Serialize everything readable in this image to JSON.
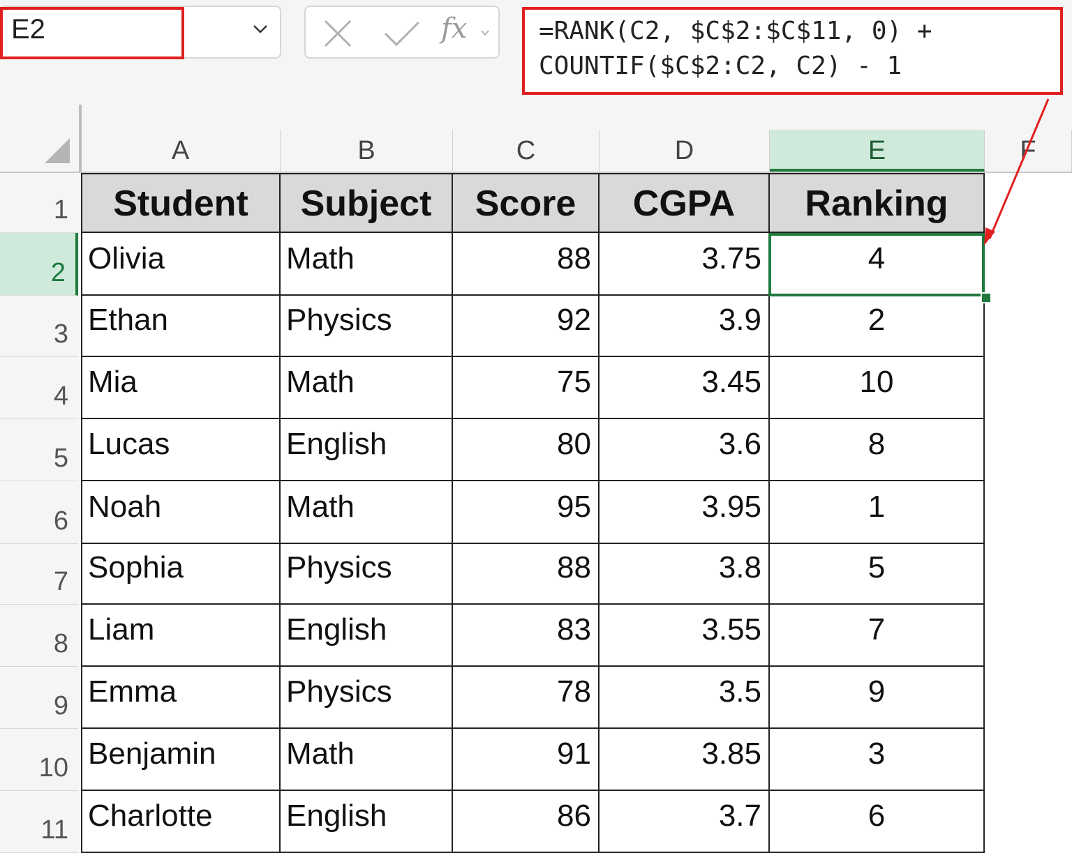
{
  "name_box": {
    "value": "E2"
  },
  "formula_bar": {
    "fx_label": "fx",
    "formula": "=RANK(C2, $C$2:$C$11, 0) +\nCOUNTIF($C$2:C2, C2) - 1"
  },
  "columns": [
    "A",
    "B",
    "C",
    "D",
    "E",
    "F"
  ],
  "active_column": "E",
  "active_row": "2",
  "table": {
    "headers": [
      "Student",
      "Subject",
      "Score",
      "CGPA",
      "Ranking"
    ],
    "rows": [
      {
        "row": "1"
      },
      {
        "row": "2",
        "cells": [
          "Olivia",
          "Math",
          "88",
          "3.75",
          "4"
        ]
      },
      {
        "row": "3",
        "cells": [
          "Ethan",
          "Physics",
          "92",
          "3.9",
          "2"
        ]
      },
      {
        "row": "4",
        "cells": [
          "Mia",
          "Math",
          "75",
          "3.45",
          "10"
        ]
      },
      {
        "row": "5",
        "cells": [
          "Lucas",
          "English",
          "80",
          "3.6",
          "8"
        ]
      },
      {
        "row": "6",
        "cells": [
          "Noah",
          "Math",
          "95",
          "3.95",
          "1"
        ]
      },
      {
        "row": "7",
        "cells": [
          "Sophia",
          "Physics",
          "88",
          "3.8",
          "5"
        ]
      },
      {
        "row": "8",
        "cells": [
          "Liam",
          "English",
          "83",
          "3.55",
          "7"
        ]
      },
      {
        "row": "9",
        "cells": [
          "Emma",
          "Physics",
          "78",
          "3.5",
          "9"
        ]
      },
      {
        "row": "10",
        "cells": [
          "Benjamin",
          "Math",
          "91",
          "3.85",
          "3"
        ]
      },
      {
        "row": "11",
        "cells": [
          "Charlotte",
          "English",
          "86",
          "3.7",
          "6"
        ]
      }
    ]
  },
  "colors": {
    "highlight_red": "#e02020",
    "selection_green": "#1f7a3e",
    "header_fill": "#d9d9d9"
  }
}
